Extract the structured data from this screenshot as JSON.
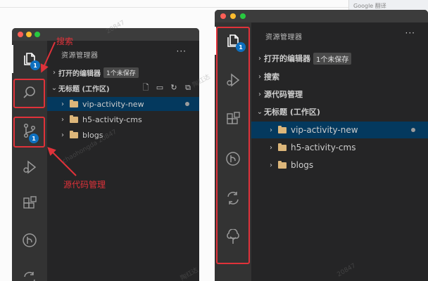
{
  "browser": {
    "tab_label": "Google 翻译"
  },
  "left_window": {
    "sidebar_title": "资源管理器",
    "more_label": "···",
    "open_editors": {
      "label": "打开的编辑器",
      "pill": "1个未保存"
    },
    "workspace": {
      "label": "无标题 (工作区)"
    },
    "folders": [
      {
        "label": "vip-activity-new"
      },
      {
        "label": "h5-activity-cms"
      },
      {
        "label": "blogs"
      }
    ],
    "badges": {
      "explorer": "1",
      "scm": "1"
    }
  },
  "right_window": {
    "sidebar_title": "资源管理器",
    "more_label": "···",
    "sections": {
      "open_editors": {
        "label": "打开的编辑器",
        "pill": "1个未保存"
      },
      "search": "搜索",
      "scm": "源代码管理",
      "workspace": "无标题 (工作区)"
    },
    "folders": [
      {
        "label": "vip-activity-new"
      },
      {
        "label": "h5-activity-cms"
      },
      {
        "label": "blogs"
      }
    ],
    "badges": {
      "explorer": "1"
    }
  },
  "annotations": {
    "search_label": "搜索",
    "scm_label": "源代码管理"
  },
  "watermarks": [
    "20847",
    "陶红达",
    "chaohongda 20847",
    "20847",
    "陶红达"
  ],
  "colors": {
    "activity_bar": "#333333",
    "sidebar": "#252526",
    "selection": "#04395e",
    "badge": "#0e70c0",
    "annotation_red": "#e0323a",
    "folder": "#dcb67a"
  }
}
